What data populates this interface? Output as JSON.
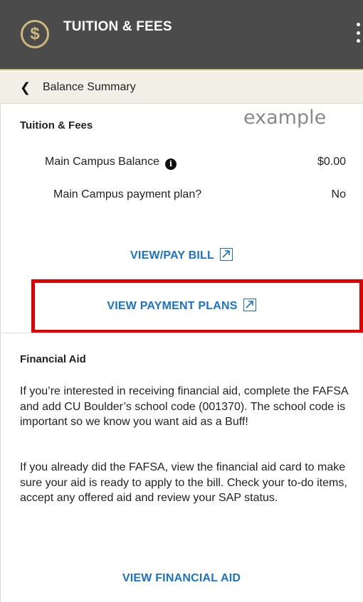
{
  "header": {
    "logo_symbol": "$",
    "title": "TUITION & FEES",
    "menu_icon": "kebab-menu-icon"
  },
  "subnav": {
    "back_icon": "chevron-left-icon",
    "label": "Balance Summary"
  },
  "watermark": "example",
  "tuition_section": {
    "title": "Tuition & Fees",
    "rows": [
      {
        "label": "Main Campus Balance",
        "value": "$0.00",
        "has_info_icon": true
      },
      {
        "label": "Main Campus payment plan?",
        "value": "No"
      }
    ],
    "links": [
      {
        "label": "VIEW/PAY BILL",
        "icon": "external-link-icon"
      },
      {
        "label": "VIEW PAYMENT PLANS",
        "icon": "external-link-icon",
        "highlighted": true
      }
    ]
  },
  "financial_aid": {
    "title": "Financial Aid",
    "paragraph_1": "If you’re interested in receiving financial aid, complete the FAFSA and add CU Boulder’s school code (001370). The school code is important so we know you want aid as a Buff!",
    "paragraph_2": "If you already did the FAFSA, view the financial aid card to make sure your aid is ready to apply to the bill. Check your to-do items, accept any offered aid and review your SAP status.",
    "link_label": "VIEW FINANCIAL AID"
  },
  "colors": {
    "header_bg": "#4b4b4b",
    "gold": "#cfb87c",
    "subnav_bg": "#f2efe6",
    "link": "#1a73c9",
    "highlight": "#e00000"
  }
}
